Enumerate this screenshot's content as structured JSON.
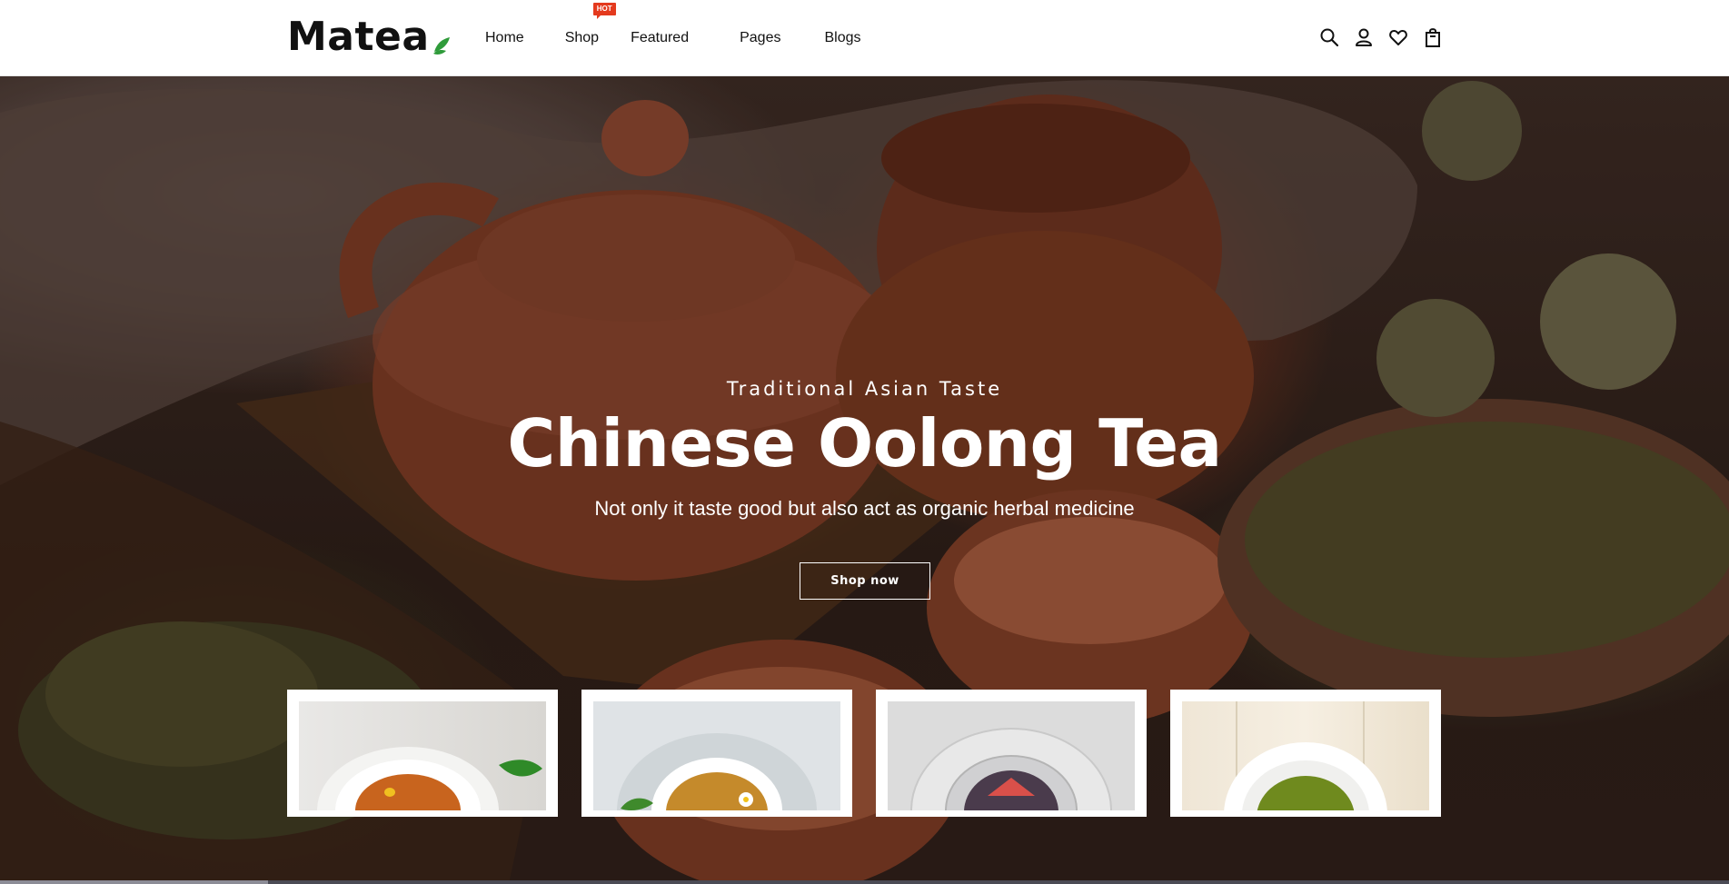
{
  "brand": {
    "name": "Matea"
  },
  "nav": {
    "items": [
      {
        "label": "Home"
      },
      {
        "label": "Shop",
        "badge": "HOT"
      },
      {
        "label": "Featured"
      },
      {
        "label": "Pages"
      },
      {
        "label": "Blogs"
      }
    ]
  },
  "header_icons": [
    "search-icon",
    "account-icon",
    "wishlist-heart-icon",
    "shopping-bag-icon"
  ],
  "hero": {
    "subtitle": "Traditional Asian Taste",
    "title": "Chinese Oolong Tea",
    "description": "Not only it taste good but also act as organic herbal medicine",
    "button_label": "Shop now"
  },
  "product_cards": [
    {
      "name": "product-card-1",
      "tea_color": "#c8641e"
    },
    {
      "name": "product-card-2",
      "tea_color": "#c58a2b"
    },
    {
      "name": "product-card-3",
      "tea_color": "#4a3b4c"
    },
    {
      "name": "product-card-4",
      "tea_color": "#6f8a1e"
    }
  ],
  "colors": {
    "accent": "#e43a1e",
    "leaf": "#2f9b3a",
    "text": "#111111"
  }
}
